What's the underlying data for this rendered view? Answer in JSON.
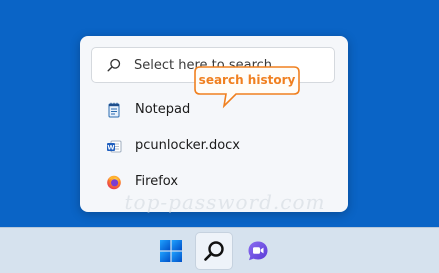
{
  "search": {
    "placeholder": "Select here to search"
  },
  "history": {
    "items": [
      {
        "label": "Notepad",
        "icon": "notepad-icon"
      },
      {
        "label": "pcunlocker.docx",
        "icon": "word-document-icon"
      },
      {
        "label": "Firefox",
        "icon": "firefox-icon"
      }
    ]
  },
  "callout": {
    "text": "search history",
    "color": "#f08020"
  },
  "watermark": {
    "text": "top-password.com"
  },
  "taskbar": {
    "buttons": [
      {
        "icon": "windows-start-icon"
      },
      {
        "icon": "search-icon",
        "active": true
      },
      {
        "icon": "teams-chat-icon"
      }
    ]
  },
  "colors": {
    "desktop": "#0a64c6",
    "taskbar": "#d6e2ee",
    "flyout": "#f5f7fa",
    "accent": "#f08020"
  }
}
